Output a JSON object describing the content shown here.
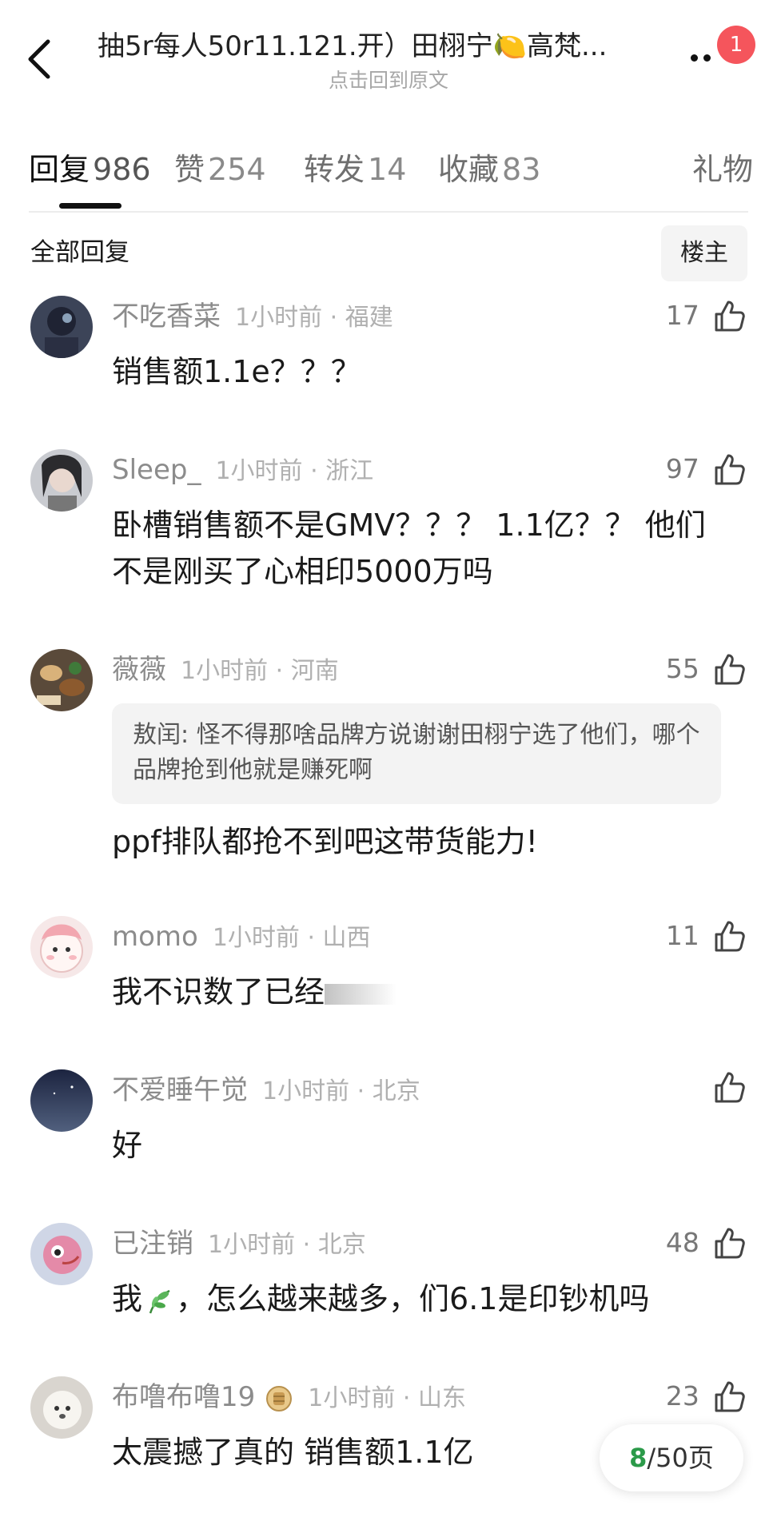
{
  "header": {
    "title": "抽5r每人50r11.121.开）田栩宁🍋高梵...",
    "subtitle": "点击回到原文",
    "notification_count": "1"
  },
  "tabs": [
    {
      "label": "回复",
      "count": "986",
      "active": true
    },
    {
      "label": "赞",
      "count": "254"
    },
    {
      "label": "转发",
      "count": "14"
    },
    {
      "label": "收藏",
      "count": "83"
    },
    {
      "label": "礼物",
      "count": ""
    }
  ],
  "section": {
    "title": "全部回复",
    "op_filter": "楼主"
  },
  "comments": [
    {
      "username": "不吃香菜",
      "time": "1小时前 · 福建",
      "likes": "17",
      "text": "销售额1.1e？？？"
    },
    {
      "username": "Sleep_",
      "time": "1小时前 · 浙江",
      "likes": "97",
      "text": "卧槽销售额不是GMV？？？ 1.1亿？？ 他们不是刚买了心相印5000万吗"
    },
    {
      "username": "薇薇",
      "time": "1小时前 · 河南",
      "likes": "55",
      "quote": "敖闰: 怪不得那啥品牌方说谢谢田栩宁选了他们，哪个品牌抢到他就是赚死啊",
      "text": "ppf排队都抢不到吧这带货能力!"
    },
    {
      "username": "momo",
      "time": "1小时前 · 山西",
      "likes": "11",
      "text": "我不识数了已经"
    },
    {
      "username": "不爱睡午觉",
      "time": "1小时前 · 北京",
      "likes": "",
      "text": "好"
    },
    {
      "username": "已注销",
      "time": "1小时前 · 北京",
      "likes": "48",
      "text_before": "我",
      "text_after": "，怎么越来越多，们6.1是印钞机吗"
    },
    {
      "username": "布噜布噜19",
      "time": "1小时前 · 山东",
      "likes": "23",
      "text": "太震撼了真的 销售额1.1亿"
    }
  ],
  "pager": {
    "current": "8",
    "total": "/50页"
  },
  "colors": {
    "badge": "#f5555c",
    "pager_current": "#2b9a49",
    "quote_bg": "#f3f3f3"
  }
}
